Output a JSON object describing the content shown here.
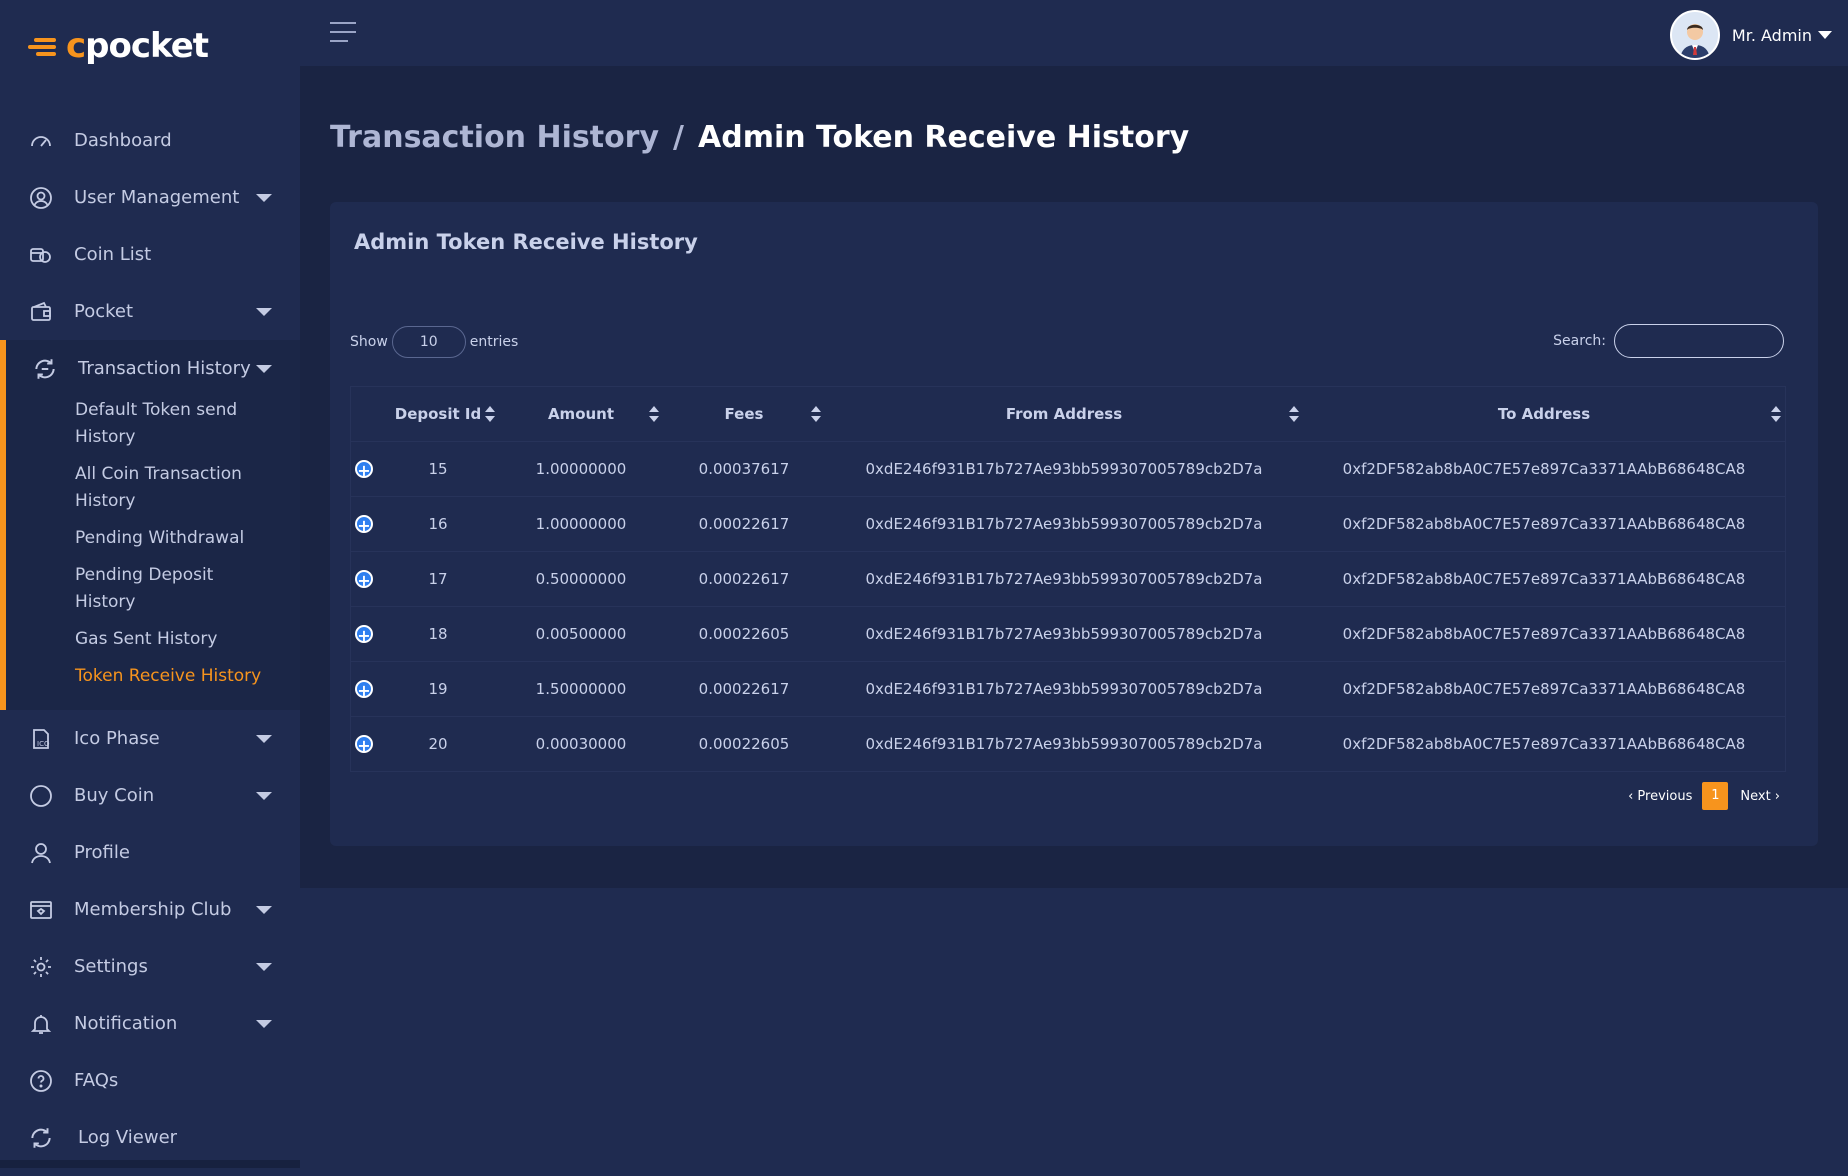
{
  "brand": {
    "logo_prefix": "c",
    "logo_rest": "pocket"
  },
  "user": {
    "name": "Mr. Admin"
  },
  "sidebar": {
    "items": [
      {
        "label": "Dashboard"
      },
      {
        "label": "User Management"
      },
      {
        "label": "Coin List"
      },
      {
        "label": "Pocket"
      },
      {
        "label": "Transaction History"
      },
      {
        "label": "Ico Phase"
      },
      {
        "label": "Buy Coin"
      },
      {
        "label": "Profile"
      },
      {
        "label": "Membership Club"
      },
      {
        "label": "Settings"
      },
      {
        "label": "Notification"
      },
      {
        "label": "FAQs"
      },
      {
        "label": "Log Viewer"
      }
    ],
    "transaction_sub": [
      {
        "line1": "Default Token send",
        "line2": "History"
      },
      {
        "line1": "All Coin Transaction",
        "line2": "History"
      },
      {
        "line1": "Pending Withdrawal",
        "line2": ""
      },
      {
        "line1": "Pending Deposit",
        "line2": "History"
      },
      {
        "line1": "Gas Sent History",
        "line2": ""
      },
      {
        "line1": "Token Receive History",
        "line2": ""
      }
    ]
  },
  "breadcrumb": {
    "parent": "Transaction History",
    "separator": "/",
    "current": "Admin Token Receive History"
  },
  "card": {
    "title": "Admin Token Receive History",
    "show_label": "Show",
    "entries_value": "10",
    "entries_label": "entries",
    "search_label": "Search:"
  },
  "table": {
    "headers": [
      "Deposit Id",
      "Amount",
      "Fees",
      "From Address",
      "To Address"
    ],
    "rows": [
      {
        "id": "15",
        "amount": "1.00000000",
        "fees": "0.00037617",
        "from": "0xdE246f931B17b727Ae93bb599307005789cb2D7a",
        "to": "0xf2DF582ab8bA0C7E57e897Ca3371AAbB68648CA8"
      },
      {
        "id": "16",
        "amount": "1.00000000",
        "fees": "0.00022617",
        "from": "0xdE246f931B17b727Ae93bb599307005789cb2D7a",
        "to": "0xf2DF582ab8bA0C7E57e897Ca3371AAbB68648CA8"
      },
      {
        "id": "17",
        "amount": "0.50000000",
        "fees": "0.00022617",
        "from": "0xdE246f931B17b727Ae93bb599307005789cb2D7a",
        "to": "0xf2DF582ab8bA0C7E57e897Ca3371AAbB68648CA8"
      },
      {
        "id": "18",
        "amount": "0.00500000",
        "fees": "0.00022605",
        "from": "0xdE246f931B17b727Ae93bb599307005789cb2D7a",
        "to": "0xf2DF582ab8bA0C7E57e897Ca3371AAbB68648CA8"
      },
      {
        "id": "19",
        "amount": "1.50000000",
        "fees": "0.00022617",
        "from": "0xdE246f931B17b727Ae93bb599307005789cb2D7a",
        "to": "0xf2DF582ab8bA0C7E57e897Ca3371AAbB68648CA8"
      },
      {
        "id": "20",
        "amount": "0.00030000",
        "fees": "0.00022605",
        "from": "0xdE246f931B17b727Ae93bb599307005789cb2D7a",
        "to": "0xf2DF582ab8bA0C7E57e897Ca3371AAbB68648CA8"
      }
    ]
  },
  "pagination": {
    "previous": "‹ Previous",
    "current": "1",
    "next": "Next ›"
  },
  "colors": {
    "accent": "#f7941d",
    "background": "#1f2b50",
    "content_bg": "#1a2443",
    "expand_icon": "#2e7ff0"
  },
  "icons": {
    "dashboard": "speedometer-icon",
    "user_management": "user-circle-icon",
    "coin_list": "coins-icon",
    "pocket": "wallet-icon",
    "transaction_history": "exchange-icon",
    "ico_phase": "ico-document-icon",
    "buy_coin": "circle-icon",
    "profile": "user-icon",
    "membership_club": "membership-card-icon",
    "settings": "gear-icon",
    "notification": "bell-icon",
    "faqs": "question-icon",
    "log_viewer": "log-icon",
    "row_expand": "plus-circle-icon"
  }
}
